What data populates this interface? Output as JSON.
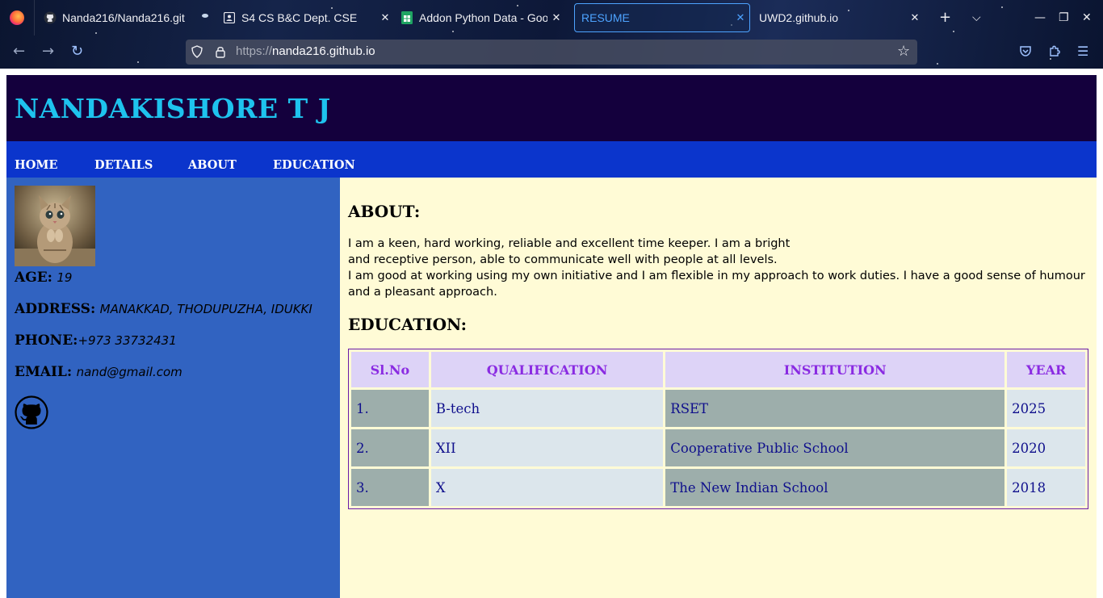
{
  "browser": {
    "tabs": [
      {
        "title": "Nanda216/Nanda216.git",
        "favicon": "github-icon"
      },
      {
        "title": "S4 CS B&C Dept. CSE",
        "favicon": "classroom-icon"
      },
      {
        "title": "Addon Python Data - Goo",
        "favicon": "sheets-icon"
      },
      {
        "title": "RESUME",
        "favicon": "none",
        "active": true
      },
      {
        "title": "UWD2.github.io",
        "favicon": "none"
      }
    ],
    "url_protocol": "https://",
    "url_host": "nanda216.github.io",
    "accent_color": "#4da3ff"
  },
  "site": {
    "name": "NANDAKISHORE T J",
    "nav": [
      "HOME",
      "DETAILS",
      "ABOUT",
      "EDUCATION"
    ],
    "profile": {
      "photo": "kitten-photo",
      "age_label": "AGE:",
      "age": "19",
      "address_label": "ADDRESS:",
      "address": "MANAKKAD, THODUPUZHA, IDUKKI",
      "phone_label": "PHONE:",
      "phone": "+973 33732431",
      "email_label": "EMAIL:",
      "email": "nand@gmail.com",
      "social_icon": "github-icon"
    },
    "about": {
      "heading": "ABOUT:",
      "lines": [
        "I am a keen, hard working, reliable and excellent time keeper. I am a bright",
        "and receptive person, able to communicate well with people at all levels.",
        "I am good at working using my own initiative and I am flexible in my approach to work duties. I have a good sense of humour and a pleasant approach."
      ]
    },
    "education": {
      "heading": "EDUCATION:",
      "headers": [
        "Sl.No",
        "QUALIFICATION",
        "INSTITUTION",
        "YEAR"
      ],
      "rows": [
        [
          "1.",
          "B-tech",
          "RSET",
          "2025"
        ],
        [
          "2.",
          "XII",
          "Cooperative Public School",
          "2020"
        ],
        [
          "3.",
          "X",
          "The New Indian School",
          "2018"
        ]
      ]
    },
    "colors": {
      "header_bg": "#14003d",
      "title": "#1ec3ee",
      "nav_bg": "#0b35cc",
      "sidebar_bg": "#3163c1",
      "main_bg": "#fffbd6"
    }
  }
}
